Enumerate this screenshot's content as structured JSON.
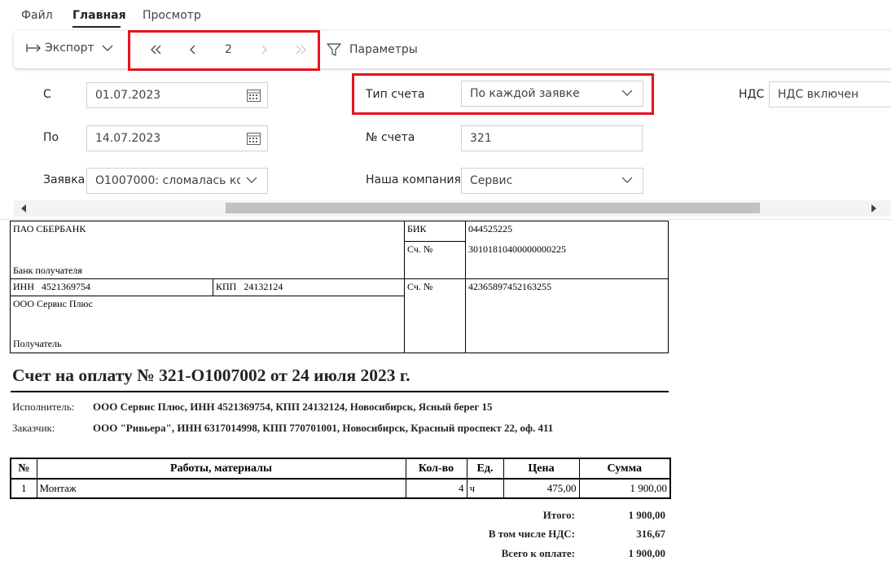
{
  "ribbon": {
    "tabs": [
      {
        "label": "Файл"
      },
      {
        "label": "Главная"
      },
      {
        "label": "Просмотр"
      }
    ],
    "active_tab": "Главная"
  },
  "toolbar": {
    "export_label": "Экспорт",
    "page_number": "2",
    "params_label": "Параметры",
    "highlight_color": "#e8121f"
  },
  "params": {
    "from": {
      "label": "С",
      "value": "01.07.2023"
    },
    "to": {
      "label": "По",
      "value": "14.07.2023"
    },
    "request": {
      "label": "Заявка",
      "value": "О1007000: сломалась ко..."
    },
    "invoice_type": {
      "label": "Тип счета",
      "value": "По каждой заявке"
    },
    "invoice_no": {
      "label": "№ счета",
      "value": "321"
    },
    "company": {
      "label": "Наша компания",
      "value": "Сервис"
    },
    "vat": {
      "label": "НДС",
      "value": "НДС включен"
    }
  },
  "bank": {
    "bank_name": "ПАО СБЕРБАНК",
    "bank_caption": "Банк получателя",
    "bik_label": "БИК",
    "bik": "044525225",
    "acc_label": "Сч. №",
    "corr_account": "30101810400000000225",
    "inn_label": "ИНН",
    "inn": "4521369754",
    "kpp_label": "КПП",
    "kpp": "24132124",
    "recipient_name": "ООО Сервис Плюс",
    "recipient_caption": "Получатель",
    "account": "42365897452163255"
  },
  "invoice": {
    "title": "Счет на оплату № 321-О1007002 от 24 июля 2023 г.",
    "executor_label": "Исполнитель:",
    "executor": "ООО Сервис Плюс, ИНН 4521369754, КПП 24132124, Новосибирск, Ясный берег 15",
    "customer_label": "Заказчик:",
    "customer": "ООО \"Ривьера\", ИНН 6317014998, КПП 770701001, Новосибирск, Красный проспект 22, оф. 411"
  },
  "items_table": {
    "headers": [
      "№",
      "Работы, материалы",
      "Кол-во",
      "Ед.",
      "Цена",
      "Сумма"
    ],
    "rows": [
      [
        "1",
        "Монтаж",
        "4",
        "ч",
        "475,00",
        "1 900,00"
      ]
    ]
  },
  "totals": {
    "total_label": "Итого:",
    "total": "1 900,00",
    "vat_label": "В том числе НДС:",
    "vat": "316,67",
    "due_label": "Всего к оплате:",
    "due": "1 900,00"
  }
}
